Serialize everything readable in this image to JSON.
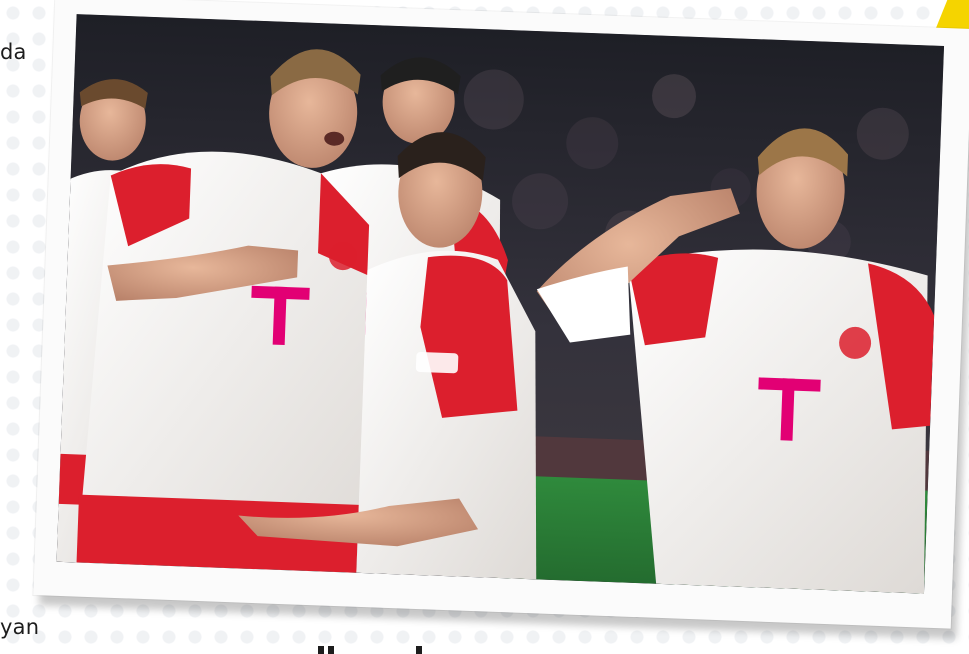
{
  "page": {
    "side_text_top": "da",
    "side_text_bottom": "yan"
  },
  "photo": {
    "subject": "soccer-players-celebrating",
    "kit_colors": {
      "shirt": "#f4f2ef",
      "red": "#dc1f2d",
      "sponsor": "#e20074"
    },
    "crowd_color": "#2a2a33",
    "pitch_color": "#2f8a3c"
  },
  "accents": {
    "yellow": "#f5d400"
  }
}
